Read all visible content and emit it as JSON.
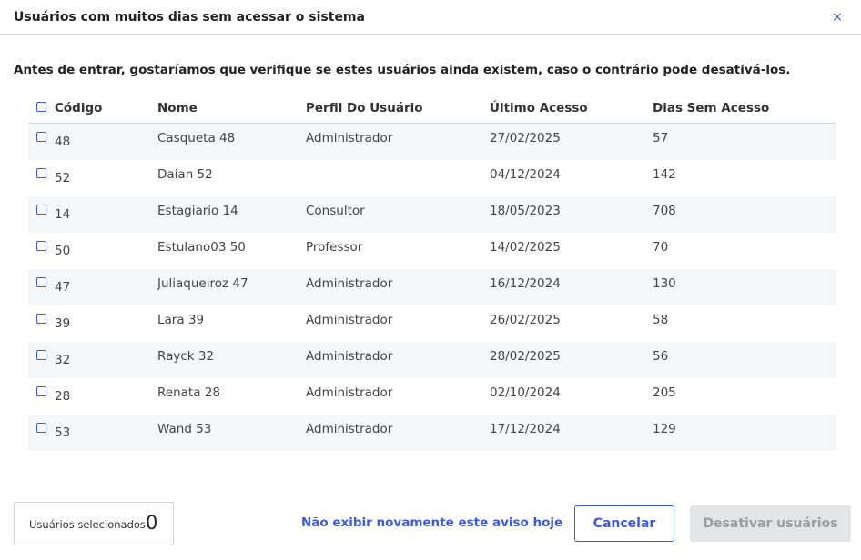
{
  "modal": {
    "title": "Usuários com muitos dias sem acessar o sistema",
    "close_icon": "×"
  },
  "instructions": "Antes de entrar, gostaríamos que verifique se estes usuários ainda existem, caso o contrário pode desativá-los.",
  "table": {
    "headers": {
      "code": "Código",
      "name": "Nome",
      "profile": "Perfil Do Usuário",
      "last_access": "Último Acesso",
      "days": "Dias Sem Acesso"
    },
    "rows": [
      {
        "code": "48",
        "name": "Casqueta 48",
        "profile": "Administrador",
        "last_access": "27/02/2025",
        "days": "57"
      },
      {
        "code": "52",
        "name": "Daian 52",
        "profile": "",
        "last_access": "04/12/2024",
        "days": "142"
      },
      {
        "code": "14",
        "name": "Estagiario 14",
        "profile": "Consultor",
        "last_access": "18/05/2023",
        "days": "708"
      },
      {
        "code": "50",
        "name": "Estulano03 50",
        "profile": "Professor",
        "last_access": "14/02/2025",
        "days": "70"
      },
      {
        "code": "47",
        "name": "Juliaqueiroz 47",
        "profile": "Administrador",
        "last_access": "16/12/2024",
        "days": "130"
      },
      {
        "code": "39",
        "name": "Lara 39",
        "profile": "Administrador",
        "last_access": "26/02/2025",
        "days": "58"
      },
      {
        "code": "32",
        "name": "Rayck 32",
        "profile": "Administrador",
        "last_access": "28/02/2025",
        "days": "56"
      },
      {
        "code": "28",
        "name": "Renata 28",
        "profile": "Administrador",
        "last_access": "02/10/2024",
        "days": "205"
      },
      {
        "code": "53",
        "name": "Wand 53",
        "profile": "Administrador",
        "last_access": "17/12/2024",
        "days": "129"
      }
    ]
  },
  "footer": {
    "selected_label": "Usuários selecionados",
    "selected_count": "0",
    "no_show_link": "Não exibir novamente este aviso hoje",
    "cancel_label": "Cancelar",
    "deactivate_label": "Desativar usuários"
  },
  "colors": {
    "accent": "#3d5adf",
    "row_alt": "#f5f6f7",
    "disabled_bg": "#e4e5e7",
    "disabled_text": "#9a9da2"
  }
}
